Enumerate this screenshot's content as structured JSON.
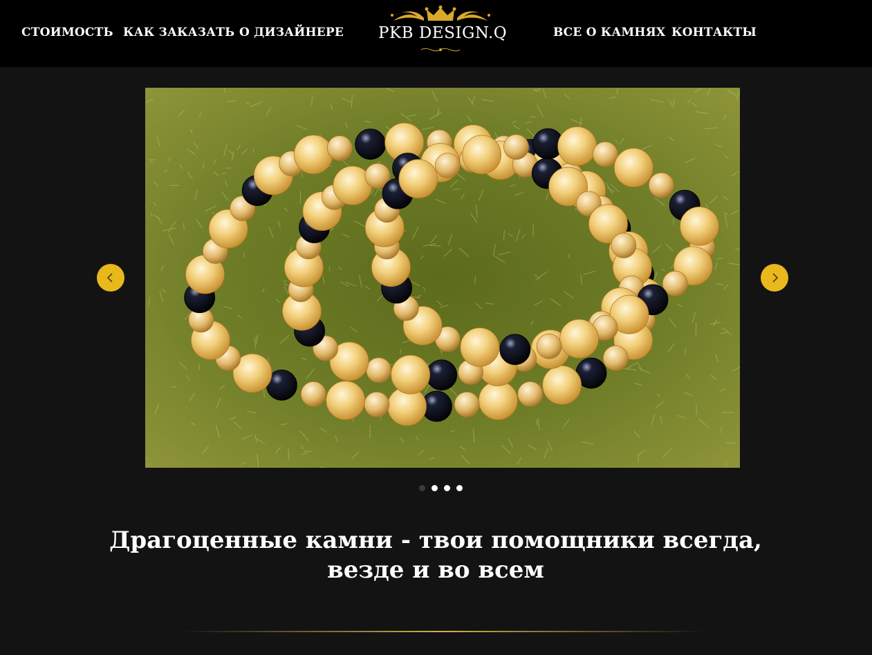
{
  "nav": {
    "left": [
      "СТОИМОСТЬ",
      "КАК ЗАКАЗАТЬ",
      "О ДИЗАЙНЕРЕ"
    ],
    "right": [
      "ВСЕ О КАМНЯХ",
      "КОНТАКТЫ"
    ]
  },
  "logo": {
    "text": "PKB DESIGN.Q",
    "icon": "crown-icon"
  },
  "slider": {
    "image_alt": "beaded necklace on moss",
    "prev_icon": "chevron-left-icon",
    "next_icon": "chevron-right-icon",
    "slide_count": 4,
    "active_index": 0
  },
  "headline": "Драгоценные камни - твои помощники всегда, везде и во всем",
  "colors": {
    "accent": "#e8b81c",
    "header_bg": "#000000",
    "page_bg": "#131313",
    "divider": "#d8b04a"
  }
}
